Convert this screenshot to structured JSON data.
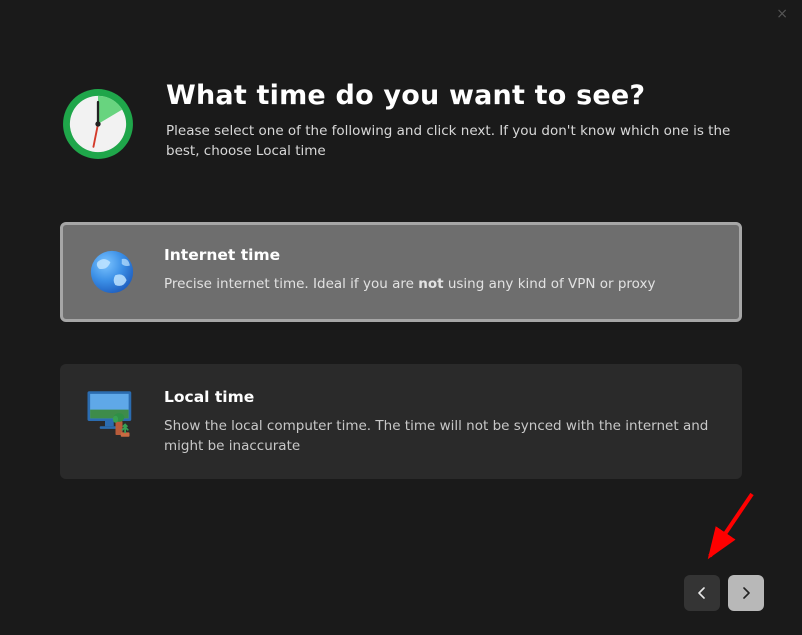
{
  "close_label": "×",
  "header": {
    "title": "What time do you want to see?",
    "subtitle": "Please select one of the following and click next. If you don't know which one is the best, choose Local time"
  },
  "options": {
    "internet": {
      "title": "Internet time",
      "desc_prefix": "Precise internet time. Ideal if you are ",
      "desc_bold": "not",
      "desc_suffix": " using any kind of VPN or proxy",
      "selected": true
    },
    "local": {
      "title": "Local time",
      "desc": "Show the local computer time. The time will not be synced with the internet and might be inaccurate",
      "selected": false
    }
  },
  "nav": {
    "back_label": "Back",
    "next_label": "Next"
  }
}
